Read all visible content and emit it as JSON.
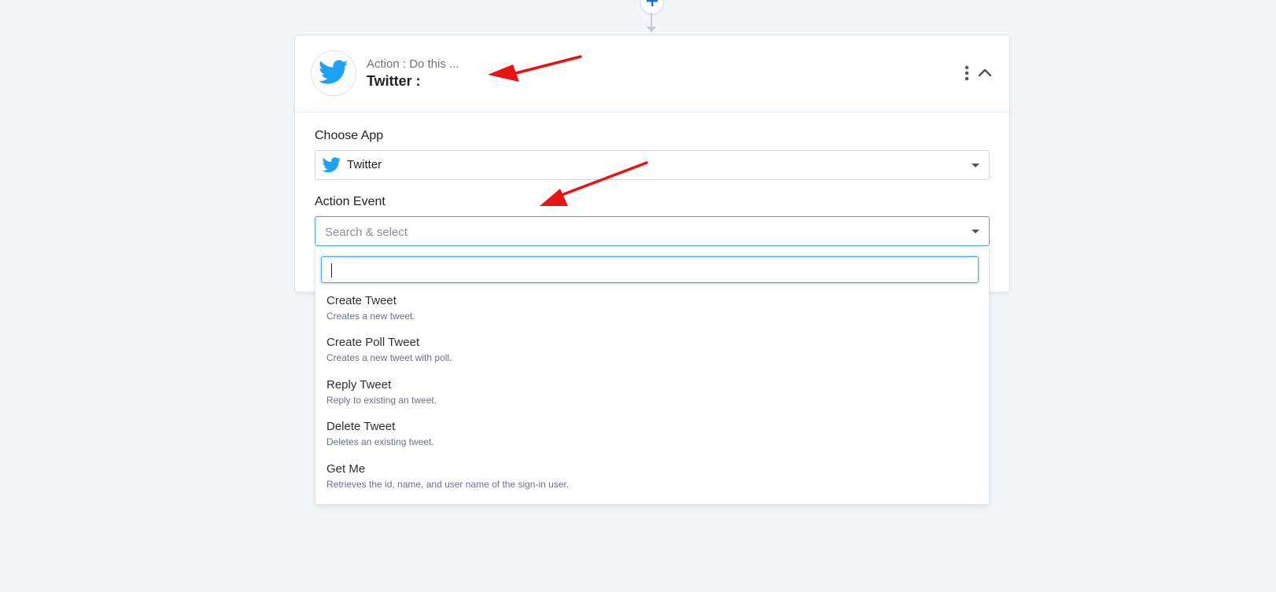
{
  "card": {
    "header": {
      "subtitle": "Action : Do this ...",
      "title": "Twitter :"
    },
    "choose_app": {
      "label": "Choose App",
      "value": "Twitter"
    },
    "action_event": {
      "label": "Action Event",
      "placeholder": "Search & select"
    }
  },
  "dropdown": {
    "search_value": "",
    "options": [
      {
        "title": "Create Tweet",
        "desc": "Creates a new tweet."
      },
      {
        "title": "Create Poll Tweet",
        "desc": "Creates a new tweet with poll."
      },
      {
        "title": "Reply Tweet",
        "desc": "Reply to existing an tweet."
      },
      {
        "title": "Delete Tweet",
        "desc": "Deletes an existing tweet."
      },
      {
        "title": "Get Me",
        "desc": "Retrieves the id, name, and user name of the sign-in user."
      }
    ]
  },
  "colors": {
    "twitter_blue": "#1da1f2",
    "focus_blue": "#4aa3df",
    "annotation_red": "#e81414"
  },
  "icons": [
    "plus-icon",
    "twitter-bird-icon",
    "kebab-menu-icon",
    "chevron-up-icon",
    "caret-down-icon"
  ]
}
